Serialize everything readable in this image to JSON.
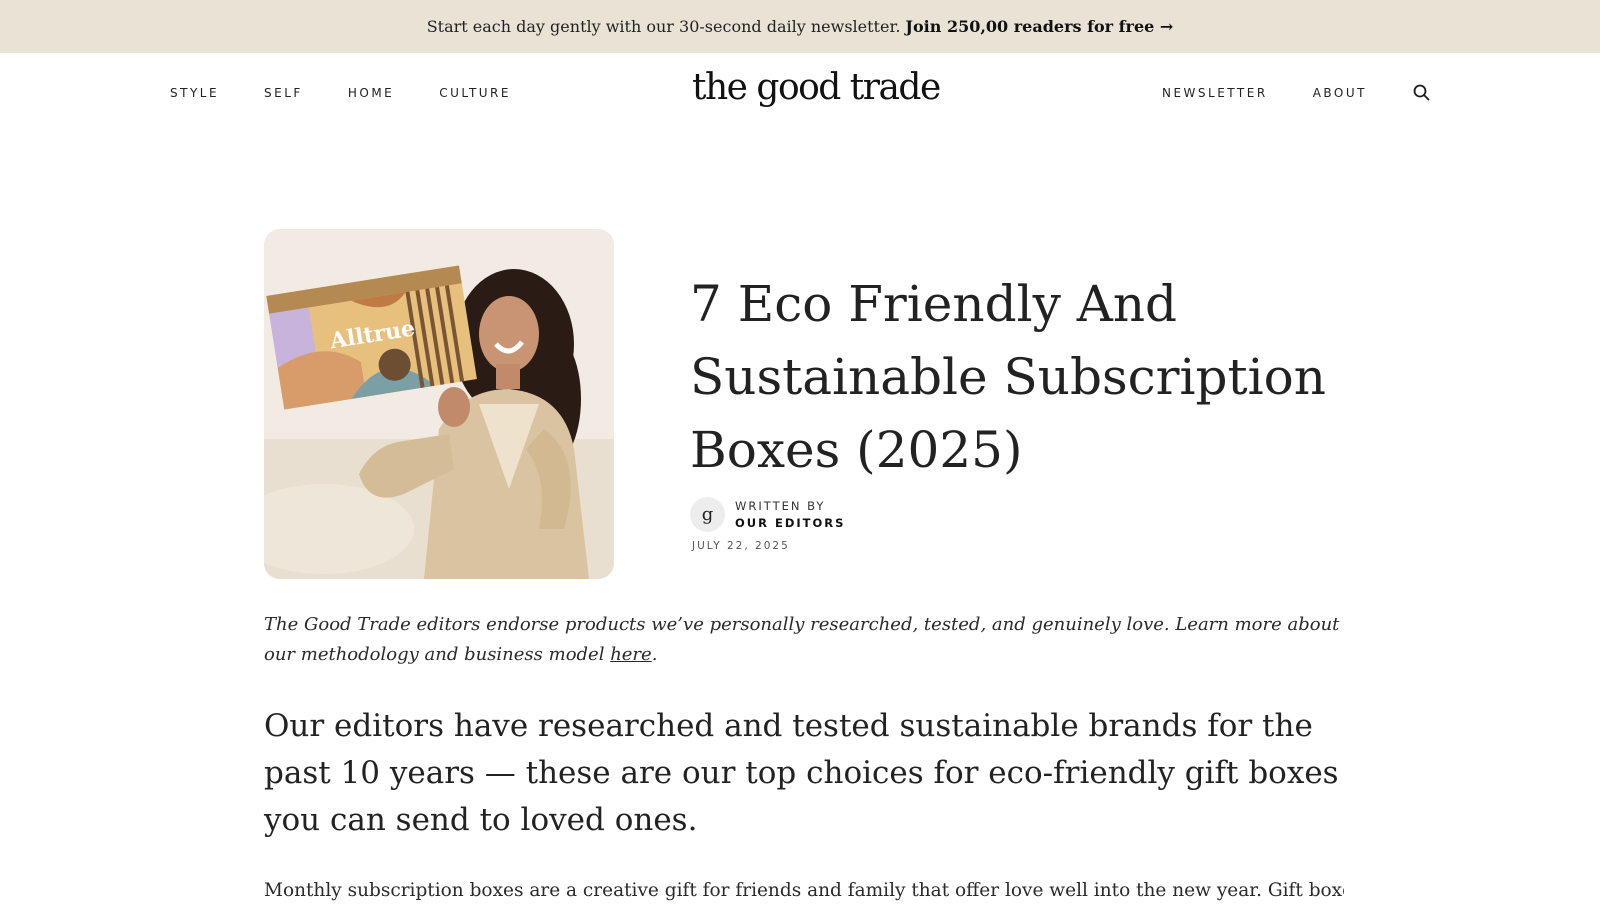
{
  "promo": {
    "text": "Start each day gently with our 30-second daily newsletter.",
    "cta": "Join 250,00 readers for free →"
  },
  "header": {
    "nav_left": [
      "STYLE",
      "SELF",
      "HOME",
      "CULTURE"
    ],
    "logo": "the good trade",
    "nav_right": [
      "NEWSLETTER",
      "ABOUT"
    ],
    "search_icon": "search-icon"
  },
  "hero": {
    "image_label": "Alltrue",
    "image_alt_icon": "photo-subscription-box"
  },
  "article": {
    "title": "7 Eco Friendly And Sustainable Subscription Boxes (2025)",
    "avatar_letter": "g",
    "written_by_label": "WRITTEN BY",
    "author": "OUR EDITORS",
    "date": "JULY 22, 2025",
    "disclosure_prefix": "The Good Trade editors endorse products we’ve personally researched, tested, and genuinely love. Learn more about our methodology and business model ",
    "disclosure_link": "here",
    "disclosure_suffix": ".",
    "lede": "Our editors have researched and tested sustainable brands for the past 10 years — these are our top choices for eco-friendly gift boxes you can send to loved ones.",
    "body_line": "Monthly subscription boxes are a creative gift for friends and family that offer love well into the new year. Gift boxes"
  },
  "colors": {
    "promo_bg": "#e9e3d6",
    "text": "#222222"
  }
}
